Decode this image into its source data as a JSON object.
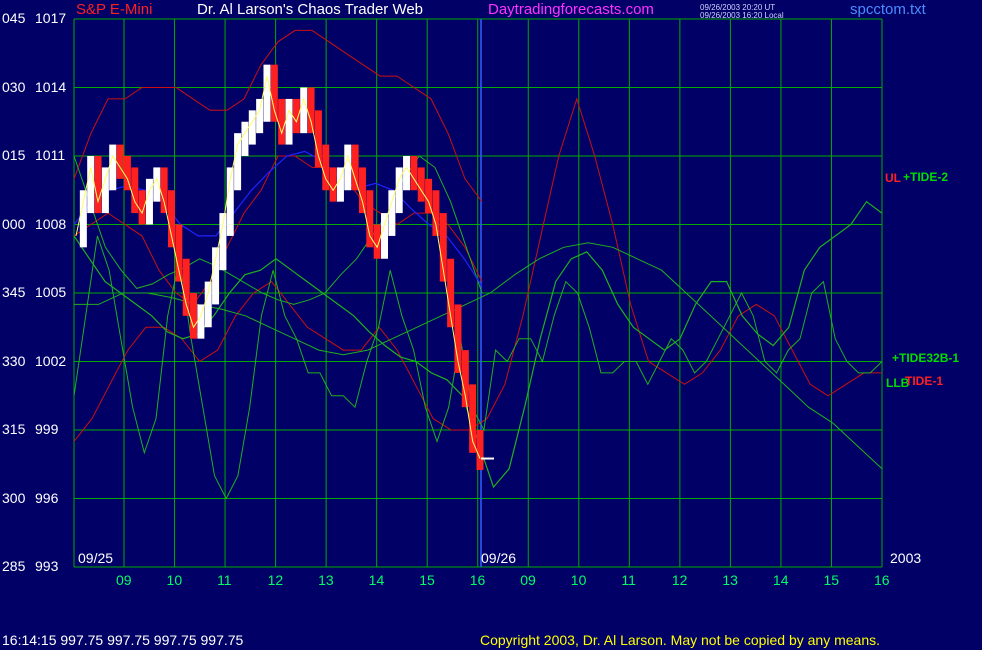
{
  "header": {
    "instrument": "S&P E-Mini",
    "author": "Dr. Al Larson's Chaos Trader Web",
    "site": "Daytradingforecasts.com",
    "time_ut": "09/26/2003 20:20 UT",
    "time_local": "09/26/2003 16:20 Local",
    "file": "spcctom.txt"
  },
  "footer": {
    "quote": "16:14:15  997.75 997.75 997.75 997.75",
    "copyright": "Copyright 2003, Dr. Al Larson. May not be copied by any means."
  },
  "colors": {
    "background": "#000066",
    "grid": "#00aa00",
    "price": "#ff2020",
    "price_up": "#ffffff",
    "red_lines": "#cc1010",
    "green_lines": "#20b020",
    "blue_line": "#2222ff",
    "yellow_line": "#ffff66"
  },
  "chart_data": {
    "type": "line",
    "y_labels": [
      {
        "time": "045",
        "price": "1017"
      },
      {
        "time": "030",
        "price": "1014"
      },
      {
        "time": "015",
        "price": "1011"
      },
      {
        "time": "000",
        "price": "1008"
      },
      {
        "time": "345",
        "price": "1005"
      },
      {
        "time": "330",
        "price": "1002"
      },
      {
        "time": "315",
        "price": "999"
      },
      {
        "time": "300",
        "price": "996"
      },
      {
        "time": "285",
        "price": "993"
      }
    ],
    "ylim": [
      993,
      1017
    ],
    "x_ticks": [
      "09",
      "10",
      "11",
      "12",
      "13",
      "14",
      "15",
      "16",
      "09",
      "10",
      "11",
      "12",
      "13",
      "14",
      "15",
      "16"
    ],
    "date_labels": [
      "09/25",
      "09/26"
    ],
    "year_label": "2003",
    "grid": true,
    "legend": [
      {
        "name": "UL",
        "color": "#ff2020"
      },
      {
        "name": "+TIDE-2",
        "color": "#00dd00"
      },
      {
        "name": "+TIDE32B-1",
        "color": "#00dd00"
      },
      {
        "name": "LLB",
        "color": "#00dd00"
      },
      {
        "name": "TIDE-1",
        "color": "#ff2020"
      }
    ],
    "price_series": [
      1007.5,
      1009,
      1010.5,
      1009,
      1010,
      1011,
      1010.5,
      1010,
      1009,
      1008.5,
      1009.5,
      1010,
      1009,
      1007.5,
      1006,
      1004.5,
      1003.5,
      1004,
      1005,
      1006.5,
      1008,
      1010,
      1011.5,
      1012,
      1012.5,
      1013,
      1014.5,
      1013,
      1012,
      1013,
      1012.5,
      1013.5,
      1012.5,
      1011,
      1010,
      1009.5,
      1010,
      1011,
      1010,
      1009,
      1007.5,
      1007,
      1008,
      1009,
      1010,
      1010.5,
      1010,
      1009.5,
      1009,
      1008,
      1006,
      1004,
      1002,
      1000.5,
      998.5,
      997.75
    ],
    "series": [
      {
        "values": [
          1007.5,
          1008,
          1008.5,
          1008,
          1007.5,
          1006,
          1005,
          1004.5,
          1005.5,
          1007,
          1008.5,
          1009.5,
          1011,
          1011,
          1010.5,
          1010.5,
          1010,
          1009,
          1008.5,
          1008,
          1008.5,
          1008.5,
          1008,
          1007,
          1005.5
        ]
      },
      {
        "values": [
          1010,
          1012,
          1013.5,
          1013.5,
          1014,
          1014,
          1014,
          1013.5,
          1013,
          1013,
          1013.5,
          1015,
          1016,
          1016.5,
          1016.5,
          1016,
          1015.5,
          1015,
          1014.5,
          1014.5,
          1014,
          1013.5,
          1012,
          1010,
          1009
        ]
      },
      {
        "values": [
          998.5,
          999.5,
          1001,
          1002.5,
          1003.5,
          1003.5,
          1003,
          1002,
          1002.5,
          1004,
          1005,
          1005.5,
          1004.5,
          1003.5,
          1003,
          1002.5,
          1002.5,
          1003.5,
          1002.5,
          1001,
          999.5,
          999,
          999,
          999.5,
          1001,
          1004,
          1007.5,
          1011,
          1013.5,
          1011,
          1008,
          1004.5,
          1002,
          1001.5,
          1001,
          1001.5,
          1002.5,
          1004,
          1004.5,
          1004,
          1002.5,
          1001,
          1000.5,
          1001,
          1001.5,
          1001.5
        ]
      },
      {
        "values": [
          1004.5,
          1004.5,
          1005,
          1005,
          1004.8,
          1004.5,
          1004.3,
          1004,
          1003.5,
          1003,
          1002.5,
          1002.3,
          1002.5,
          1003,
          1003.5,
          1004,
          1004.5,
          1005,
          1005.8,
          1006.5,
          1007,
          1007.2,
          1007,
          1006.5,
          1006,
          1005,
          1004,
          1003,
          1002,
          1001,
          1000,
          999.3,
          998.3,
          997.3
        ]
      },
      {
        "values": [
          1011,
          1009,
          1007,
          1006,
          1005.2,
          1005.4,
          1005.8,
          1006.1,
          1006.5,
          1006.2,
          1005.8,
          1005.4,
          1005,
          1004.7,
          1004.5,
          1004.7,
          1005,
          1005.8,
          1006.5,
          1007.5,
          1008.5,
          1010,
          1011,
          1010.5,
          1009,
          1007,
          1005
        ]
      },
      {
        "values": [
          1007.5,
          1006.5,
          1005.5,
          1005,
          1004.5,
          1004,
          1003.3,
          1003,
          1003.2,
          1004,
          1005,
          1005.8,
          1006,
          1006.5,
          1006,
          1005.5,
          1005,
          1004.5,
          1004,
          1003.3,
          1002.7,
          1002.2,
          1002,
          1001.5,
          1001.2,
          1000.5,
          998.5,
          996.5,
          997.3,
          1000,
          1003,
          1005.5,
          1006.5,
          1006.8,
          1006,
          1004.5,
          1003.5,
          1003,
          1002.5,
          1003,
          1004.5,
          1005.5,
          1005.5,
          1004,
          1003.2,
          1002.7,
          1003.5,
          1006,
          1007,
          1007.5,
          1008,
          1009,
          1008.5
        ]
      },
      {
        "values": [
          1000.5,
          1004,
          1007.5,
          1006,
          1003,
          1000,
          998,
          999.5,
          1004,
          1006.5,
          1003,
          1000,
          997,
          996,
          997,
          1000,
          1004,
          1006,
          1004,
          1003,
          1001.5,
          1001.5,
          1000.5,
          1000.5,
          1000,
          1002,
          1003.5,
          1006,
          1004,
          1002.5,
          1000,
          998.5,
          1000,
          1003,
          1000,
          999,
          1002.5,
          1002,
          1003,
          1003,
          1002,
          1004,
          1005.5,
          1005,
          1003.5,
          1001.5,
          1001.5,
          1002,
          1002,
          1001,
          1002,
          1003,
          1002.5,
          1001.5,
          1002,
          1003,
          1004,
          1005,
          1004,
          1002,
          1001.5,
          1002.5,
          1003,
          1005,
          1005.5,
          1003,
          1002,
          1001.5,
          1001.5,
          1002
        ]
      },
      {
        "values": [
          1008,
          1009,
          1009.5,
          1009.7,
          1009.5,
          1009,
          1008,
          1007.5,
          1007.5,
          1008.5,
          1009.5,
          1010.3,
          1011,
          1011.2,
          1010.8,
          1010,
          1009.6,
          1009.8,
          1009.5,
          1008.7,
          1008,
          1007.5,
          1006.5,
          1005.3
        ]
      }
    ]
  }
}
